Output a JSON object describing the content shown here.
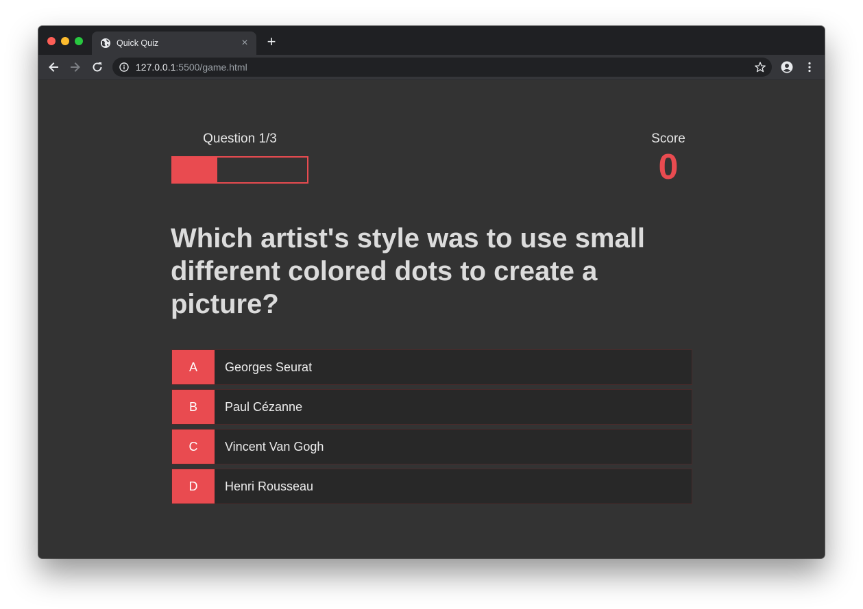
{
  "browser": {
    "tab_title": "Quick Quiz",
    "url_host": "127.0.0.1",
    "url_rest": ":5500/game.html",
    "new_tab": "+",
    "tab_close": "×"
  },
  "hud": {
    "question_counter": "Question 1/3",
    "progress_fraction": 0.333,
    "score_label": "Score",
    "score_value": "0"
  },
  "question": {
    "text": "Which artist's style was to use small different colored dots to create a picture?"
  },
  "choices": [
    {
      "prefix": "A",
      "text": "Georges Seurat"
    },
    {
      "prefix": "B",
      "text": "Paul Cézanne"
    },
    {
      "prefix": "C",
      "text": "Vincent Van Gogh"
    },
    {
      "prefix": "D",
      "text": "Henri Rousseau"
    }
  ],
  "colors": {
    "accent": "#e94b50",
    "page_bg": "#333333",
    "choice_bg": "#282828"
  }
}
